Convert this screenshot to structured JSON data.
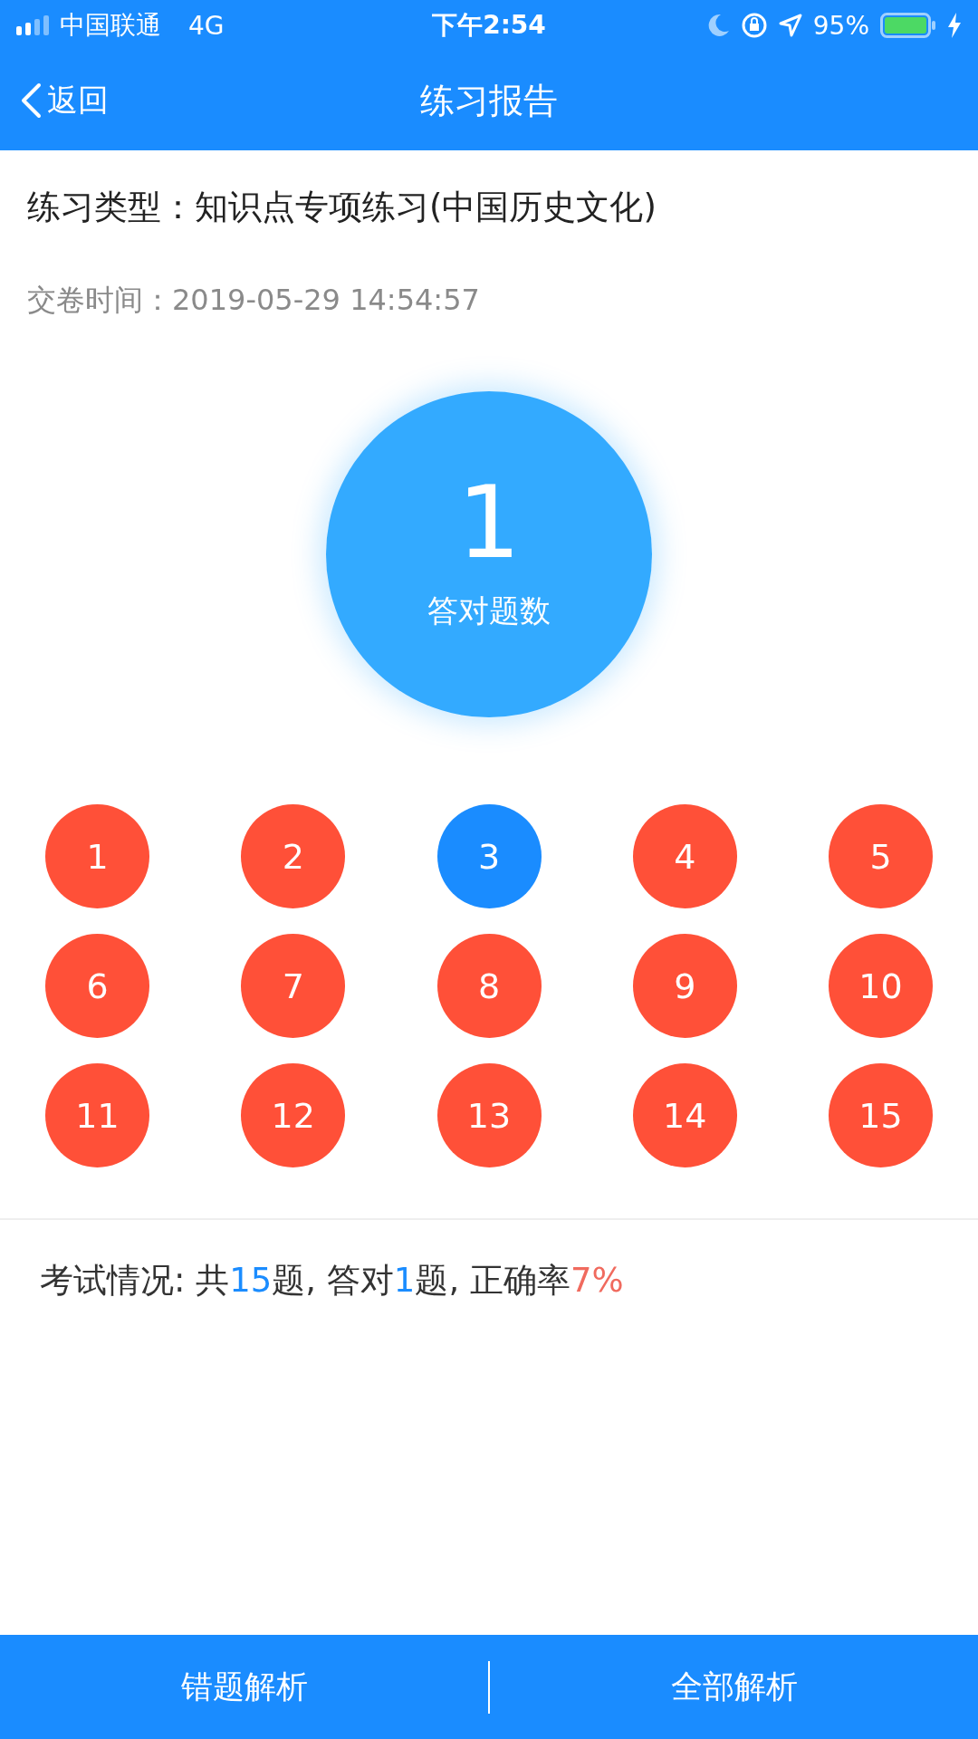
{
  "status_bar": {
    "carrier": "中国联通",
    "network": "4G",
    "time": "下午2:54",
    "battery": "95%"
  },
  "nav": {
    "back": "返回",
    "title": "练习报告"
  },
  "practice_type": "练习类型：知识点专项练习(中国历史文化)",
  "submit_time": "交卷时间：2019-05-29 14:54:57",
  "score": {
    "value": "1",
    "label": "答对题数"
  },
  "questions": [
    {
      "number": "1",
      "correct": false
    },
    {
      "number": "2",
      "correct": false
    },
    {
      "number": "3",
      "correct": true
    },
    {
      "number": "4",
      "correct": false
    },
    {
      "number": "5",
      "correct": false
    },
    {
      "number": "6",
      "correct": false
    },
    {
      "number": "7",
      "correct": false
    },
    {
      "number": "8",
      "correct": false
    },
    {
      "number": "9",
      "correct": false
    },
    {
      "number": "10",
      "correct": false
    },
    {
      "number": "11",
      "correct": false
    },
    {
      "number": "12",
      "correct": false
    },
    {
      "number": "13",
      "correct": false
    },
    {
      "number": "14",
      "correct": false
    },
    {
      "number": "15",
      "correct": false
    }
  ],
  "summary": [
    {
      "text": "考试情况: 共",
      "kind": "plain"
    },
    {
      "text": "15",
      "kind": "highlight"
    },
    {
      "text": "题, 答对",
      "kind": "plain"
    },
    {
      "text": "1",
      "kind": "highlight"
    },
    {
      "text": "题, 正确率",
      "kind": "plain"
    },
    {
      "text": "7%",
      "kind": "warning"
    }
  ],
  "buttons": [
    "错题解析",
    "全部解析"
  ]
}
